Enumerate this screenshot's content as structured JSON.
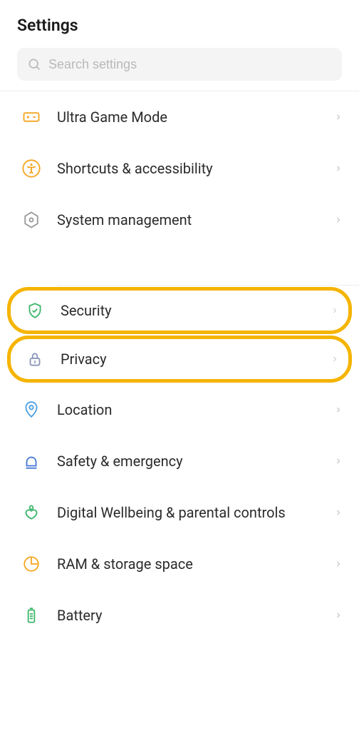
{
  "header": {
    "title": "Settings"
  },
  "search": {
    "placeholder": "Search settings"
  },
  "colors": {
    "orange": "#f5a623",
    "green": "#3fb66c",
    "blue": "#4a79d6",
    "lightblue": "#4da0e0",
    "grey": "#a8a8a8",
    "greyIcon": "#7f7f7f",
    "highlight": "#f5b400"
  },
  "items": [
    {
      "id": "ultra-game-mode",
      "label": "Ultra Game Mode",
      "icon": "game-controller-icon",
      "group": 1
    },
    {
      "id": "shortcuts-accessibility",
      "label": "Shortcuts & accessibility",
      "icon": "accessibility-icon",
      "group": 1
    },
    {
      "id": "system-management",
      "label": "System management",
      "icon": "gear-hex-icon",
      "group": 1
    },
    {
      "id": "security",
      "label": "Security",
      "icon": "shield-check-icon",
      "group": 2,
      "highlighted": true
    },
    {
      "id": "privacy",
      "label": "Privacy",
      "icon": "lock-icon",
      "group": 2,
      "highlighted": true
    },
    {
      "id": "location",
      "label": "Location",
      "icon": "location-pin-icon",
      "group": 2
    },
    {
      "id": "safety-emergency",
      "label": "Safety & emergency",
      "icon": "bell-icon",
      "group": 2
    },
    {
      "id": "digital-wellbeing",
      "label": "Digital Wellbeing & parental controls",
      "icon": "heart-person-icon",
      "group": 2
    },
    {
      "id": "ram-storage",
      "label": "RAM & storage space",
      "icon": "pie-clock-icon",
      "group": 2
    },
    {
      "id": "battery",
      "label": "Battery",
      "icon": "battery-icon",
      "group": 2
    }
  ]
}
